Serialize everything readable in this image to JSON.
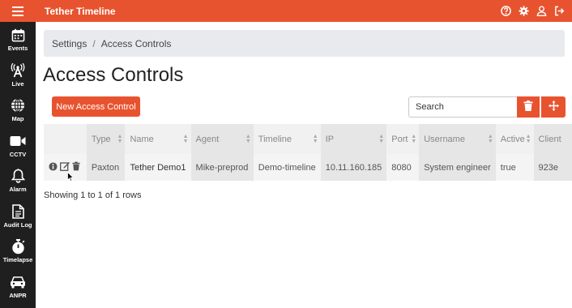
{
  "app": {
    "title": "Tether Timeline"
  },
  "topbar": {
    "icons": [
      "help-icon",
      "gear-icon",
      "user-icon",
      "logout-icon"
    ]
  },
  "sidebar": {
    "items": [
      {
        "label": "Events",
        "icon": "calendar-icon"
      },
      {
        "label": "Live",
        "icon": "antenna-icon"
      },
      {
        "label": "Map",
        "icon": "globe-icon"
      },
      {
        "label": "CCTV",
        "icon": "video-camera-icon"
      },
      {
        "label": "Alarm",
        "icon": "bell-icon"
      },
      {
        "label": "Audit Log",
        "icon": "document-icon"
      },
      {
        "label": "Timelapse",
        "icon": "stopwatch-icon"
      },
      {
        "label": "ANPR",
        "icon": "car-icon"
      }
    ]
  },
  "breadcrumb": {
    "parent": "Settings",
    "separator": "/",
    "current": "Access Controls"
  },
  "page": {
    "title": "Access Controls"
  },
  "toolbar": {
    "new_label": "New Access Control",
    "search_placeholder": "Search"
  },
  "table": {
    "columns": [
      "Type",
      "Name",
      "Agent",
      "Timeline",
      "IP",
      "Port",
      "Username",
      "Active",
      "Client"
    ],
    "rows": [
      {
        "type": "Paxton",
        "name": "Tether Demo1",
        "agent": "Mike-preprod",
        "timeline": "Demo-timeline",
        "ip": "10.11.160.185",
        "port": "8080",
        "username": "System engineer",
        "active": "true",
        "client": "923e"
      }
    ]
  },
  "pagination": {
    "info": "Showing 1 to 1 of 1 rows"
  },
  "colors": {
    "accent": "#e8532f",
    "sidebar": "#1f1f1f"
  }
}
